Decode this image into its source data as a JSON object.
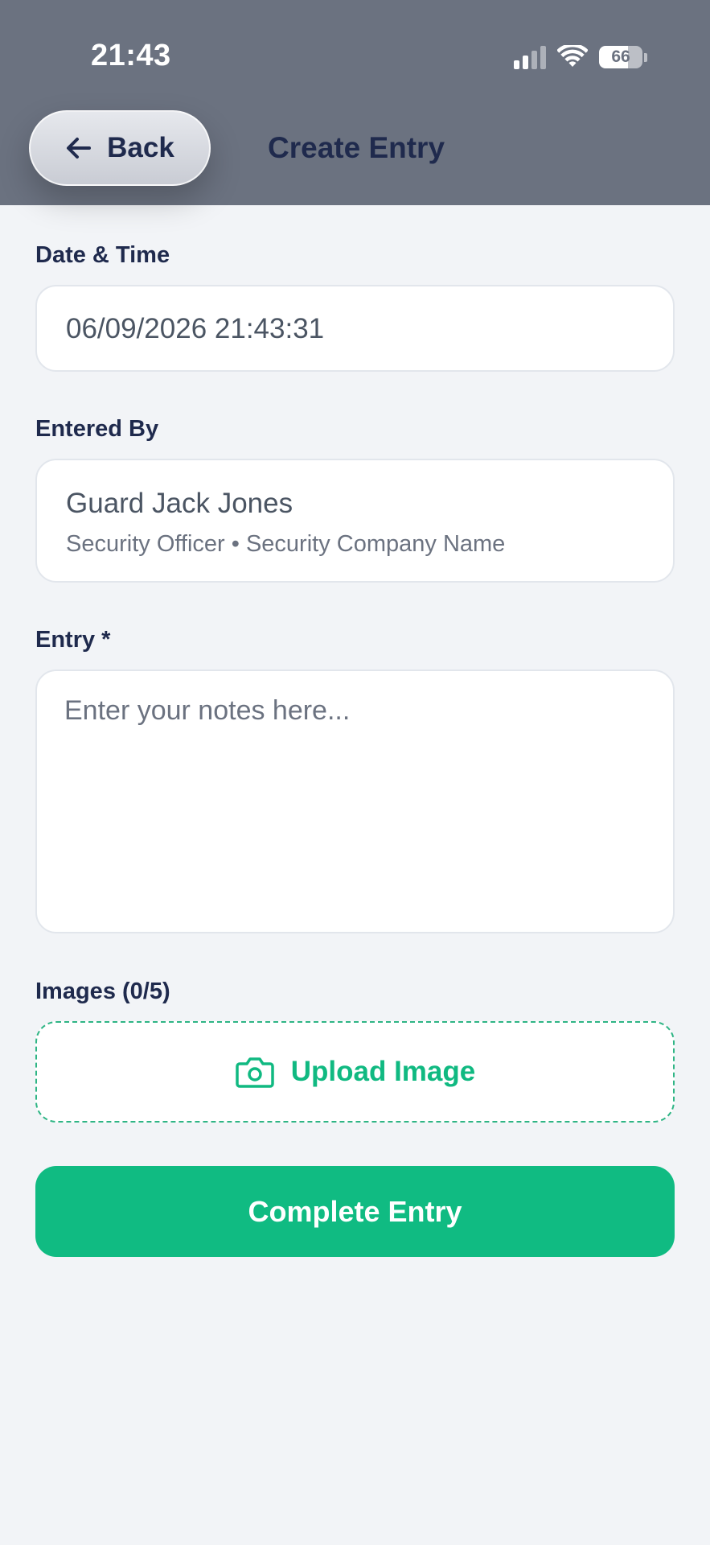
{
  "status_bar": {
    "time": "21:43",
    "battery_level": "66",
    "battery_percent": 66
  },
  "header": {
    "back_label": "Back",
    "title": "Create Entry"
  },
  "form": {
    "datetime": {
      "label": "Date & Time",
      "value": "06/09/2026 21:43:31"
    },
    "entered_by": {
      "label": "Entered By",
      "name": "Guard Jack Jones",
      "role_line": "Security Officer • Security Company Name"
    },
    "entry": {
      "label": "Entry *",
      "placeholder": "Enter your notes here...",
      "value": ""
    },
    "images": {
      "label": "Images (0/5)",
      "upload_label": "Upload Image"
    },
    "complete_label": "Complete Entry"
  },
  "colors": {
    "header_bg": "#6b7280",
    "page_bg": "#f2f4f7",
    "accent_green": "#10bb82",
    "text_dark": "#1f2a4d",
    "text_muted": "#6b7280"
  },
  "icons": {
    "back": "arrow-left-icon",
    "upload": "camera-icon",
    "signal": "cellular-signal-icon",
    "wifi": "wifi-icon",
    "battery": "battery-icon"
  }
}
